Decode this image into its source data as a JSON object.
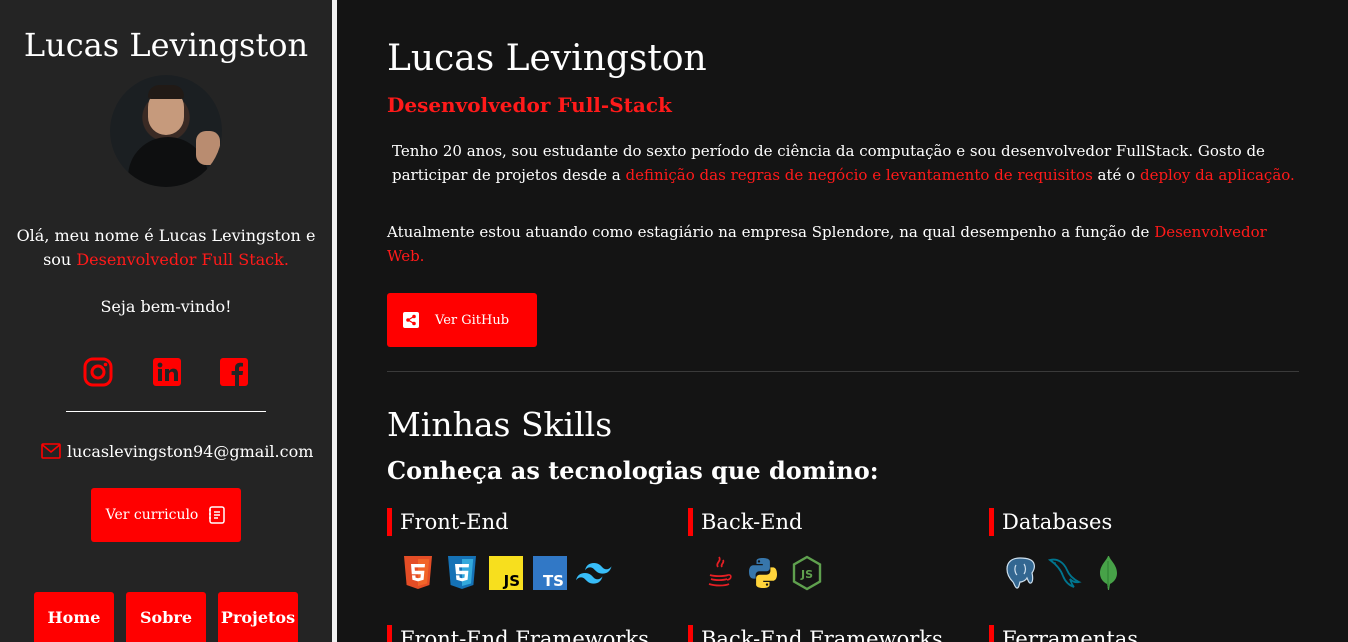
{
  "sidebar": {
    "name": "Lucas Levingston",
    "intro_text": "Olá, meu nome é Lucas Levingston e sou ",
    "intro_highlight": "Desenvolvedor Full Stack.",
    "welcome": "Seja bem-vindo!",
    "email": "lucaslevingston94@gmail.com",
    "cv_button": "Ver curriculo",
    "nav": [
      {
        "label": "Home"
      },
      {
        "label": "Sobre"
      },
      {
        "label": "Projetos"
      }
    ],
    "socials": [
      "instagram-icon",
      "linkedin-icon",
      "facebook-icon"
    ]
  },
  "main": {
    "name": "Lucas Levingston",
    "role": "Desenvolvedor Full-Stack",
    "p1_a": "Tenho 20 anos, sou estudante do sexto período de ciência da computação e sou desenvolvedor FullStack. Gosto de participar de projetos desde a ",
    "p1_hl1": "definição das regras de negócio e levantamento de requisitos",
    "p1_b": " até o ",
    "p1_hl2": "deploy da aplicação.",
    "p2_a": "Atualmente estou atuando como estagiário na empresa Splendore, na qual desempenho a função de ",
    "p2_hl": "Desenvolvedor Web.",
    "github_button": "Ver GitHub",
    "skills_title": "Minhas Skills",
    "skills_subtitle": "Conheça as tecnologias que domino:",
    "categories": [
      {
        "title": "Front-End",
        "icons": [
          "html5-icon",
          "css3-icon",
          "javascript-icon",
          "typescript-icon",
          "tailwind-icon"
        ]
      },
      {
        "title": "Back-End",
        "icons": [
          "java-icon",
          "python-icon",
          "nodejs-icon"
        ]
      },
      {
        "title": "Databases",
        "icons": [
          "postgresql-icon",
          "mysql-icon",
          "mongodb-icon"
        ]
      },
      {
        "title": "Front-End Frameworks",
        "icons": []
      },
      {
        "title": "Back-End Frameworks",
        "icons": []
      },
      {
        "title": "Ferramentas",
        "icons": []
      }
    ]
  },
  "colors": {
    "accent": "#ff0000",
    "background": "#141414",
    "sidebar": "#242424",
    "text": "#ffffff"
  }
}
